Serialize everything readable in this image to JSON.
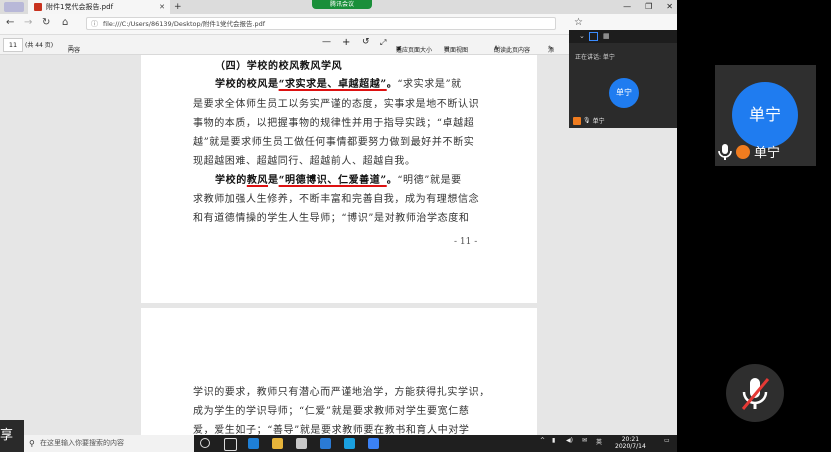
{
  "browser": {
    "tab_title": "附件1党代会报告.pdf",
    "new_tab": "+",
    "meeting_pill": "腾讯会议",
    "url": "file:///C:/Users/86139/Desktop/附件1党代会报告.pdf"
  },
  "pdf_toolbar": {
    "page_current": "11",
    "page_total": "(共 44 页)",
    "contents": "内容",
    "zoom_out": "—",
    "zoom_in": "+",
    "fit_page": "适应页面大小",
    "page_view": "页面视图",
    "read_aloud": "朗读此页内容",
    "more": "添"
  },
  "doc": {
    "page1_lines": [
      "（四）学校的校风教风学风",
      "“求实求是”就",
      "是要求全体师生员工以务实严谨的态度，实事求是地不断认识",
      "事物的本质，以把握事物的规律性并用于指导实践；“卓越超",
      "越”就是要求师生员工做任何事情都要努力做到最好并不断实",
      "现超越困难、超越同行、超越前人、超越自我。",
      "“明德”就是要",
      "求教师加强人生修养，不断丰富和完善自我，成为有理想信念",
      "和有道德情操的学生人生导师；“博识”是对教师治学态度和"
    ],
    "line1_lead": "学校的校风是",
    "line1_quote": "“求实求是、卓越超越”",
    "line1_mid": "。",
    "line6_lead": "学校的",
    "line6_key": "教风",
    "line6_mid": "是",
    "line6_quote": "“明德博识、仁爱善道”",
    "line6_end": "。",
    "page_number": "- 11 -",
    "page2_lines": [
      "学识的要求，教师只有潜心而严谨地治学，方能获得扎实学识，",
      "成为学生的学识导师；“仁爱”就是要求教师对学生要宽仁慈",
      "爱，爱生如子；“善导”就是要求教师要在教书和育人中对学"
    ]
  },
  "meeting": {
    "speaking": "正在讲话: 单宁",
    "avatar": "单宁",
    "participant_name": "单宁",
    "share_label": "享"
  },
  "taskbar": {
    "search_placeholder": "在这里输入你要搜索的内容",
    "lang": "英",
    "time": "20:21",
    "date": "2020/7/14"
  }
}
